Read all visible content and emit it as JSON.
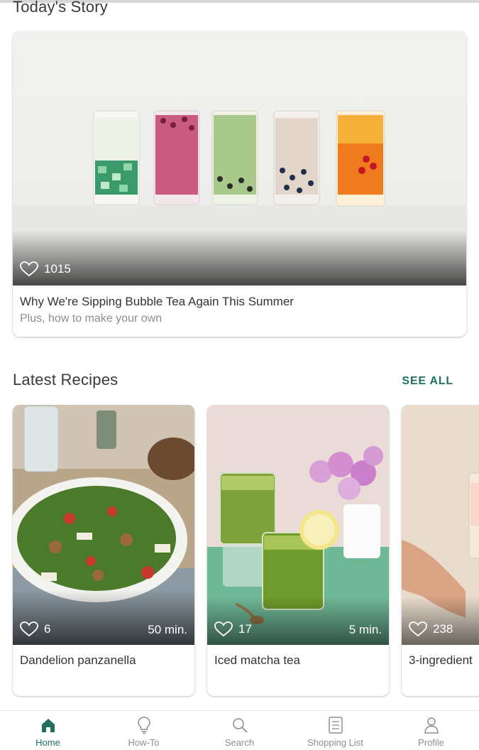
{
  "sections": {
    "story_title": "Today's Story",
    "latest_title": "Latest Recipes",
    "see_all_label": "SEE ALL"
  },
  "story": {
    "likes": "1015",
    "headline": "Why We're Sipping Bubble Tea Again This Summer",
    "subtitle": "Plus, how to make your own"
  },
  "recipes": [
    {
      "name": "Dandelion panzanella",
      "likes": "6",
      "time": "50 min."
    },
    {
      "name": "Iced matcha tea",
      "likes": "17",
      "time": "5 min."
    },
    {
      "name": "3-ingredient",
      "likes": "238",
      "time": ""
    }
  ],
  "nav": {
    "items": [
      {
        "label": "Home",
        "icon": "home-icon"
      },
      {
        "label": "How-To",
        "icon": "lightbulb-icon"
      },
      {
        "label": "Search",
        "icon": "search-icon"
      },
      {
        "label": "Shopping List",
        "icon": "shopping-list-icon"
      },
      {
        "label": "Profile",
        "icon": "profile-icon"
      }
    ]
  },
  "colors": {
    "accent": "#1f6f62",
    "inactive": "#8e8e8e",
    "text": "#333333",
    "muted": "#8c8c8c"
  }
}
